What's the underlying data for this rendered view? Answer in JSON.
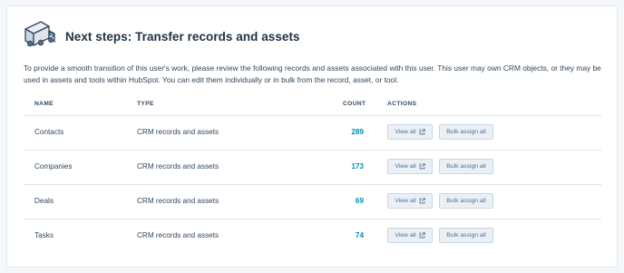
{
  "header": {
    "title": "Next steps: Transfer records and assets",
    "icon": "delivery-truck-icon"
  },
  "description": "To provide a smooth transition of this user's work, please review the following records and assets associated with this user. This user may own CRM objects, or they may be used in assets and tools within HubSpot. You can edit them individually or in bulk from the record, asset, or tool.",
  "table": {
    "columns": {
      "name": "NAME",
      "type": "TYPE",
      "count": "COUNT",
      "actions": "ACTIONS"
    },
    "rows": [
      {
        "name": "Contacts",
        "type": "CRM records and assets",
        "count": "289",
        "view_label": "View all",
        "bulk_label": "Bulk assign all"
      },
      {
        "name": "Companies",
        "type": "CRM records and assets",
        "count": "173",
        "view_label": "View all",
        "bulk_label": "Bulk assign all"
      },
      {
        "name": "Deals",
        "type": "CRM records and assets",
        "count": "69",
        "view_label": "View all",
        "bulk_label": "Bulk assign all"
      },
      {
        "name": "Tasks",
        "type": "CRM records and assets",
        "count": "74",
        "view_label": "View all",
        "bulk_label": "Bulk assign all"
      }
    ]
  },
  "colors": {
    "accent": "#0091ae",
    "heading": "#213343",
    "text": "#33475b",
    "button_bg": "#eaf0f6"
  }
}
